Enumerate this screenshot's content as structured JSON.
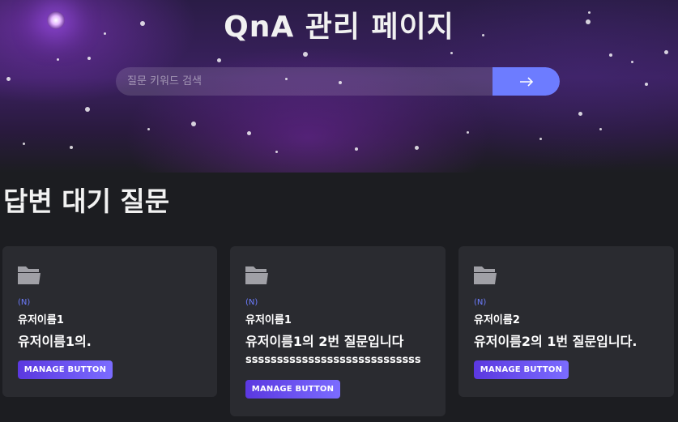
{
  "header": {
    "title": "QnA 관리 페이지"
  },
  "search": {
    "placeholder": "질문 키워드 검색",
    "button_icon": "arrow-right-icon"
  },
  "section": {
    "title": "답변 대기 질문"
  },
  "cards": [
    {
      "badge": "(N)",
      "username": "유저이름1",
      "title": "유저이름1의.",
      "body": "",
      "button_label": "MANAGE BUTTON",
      "icon": "folder-icon"
    },
    {
      "badge": "(N)",
      "username": "유저이름1",
      "title": "유저이름1의 2번 질문입니다",
      "body": "ssssssssssssssssssssssssssss",
      "button_label": "MANAGE BUTTON",
      "icon": "folder-icon"
    },
    {
      "badge": "(N)",
      "username": "유저이름2",
      "title": "유저이름2의 1번 질문입니다.",
      "body": "",
      "button_label": "MANAGE BUTTON",
      "icon": "folder-icon"
    }
  ],
  "colors": {
    "accent": "#6d7cff",
    "background": "#1c1d21",
    "card": "#2a2b30",
    "button_gradient_start": "#5b38e0",
    "button_gradient_end": "#7b6cff"
  }
}
